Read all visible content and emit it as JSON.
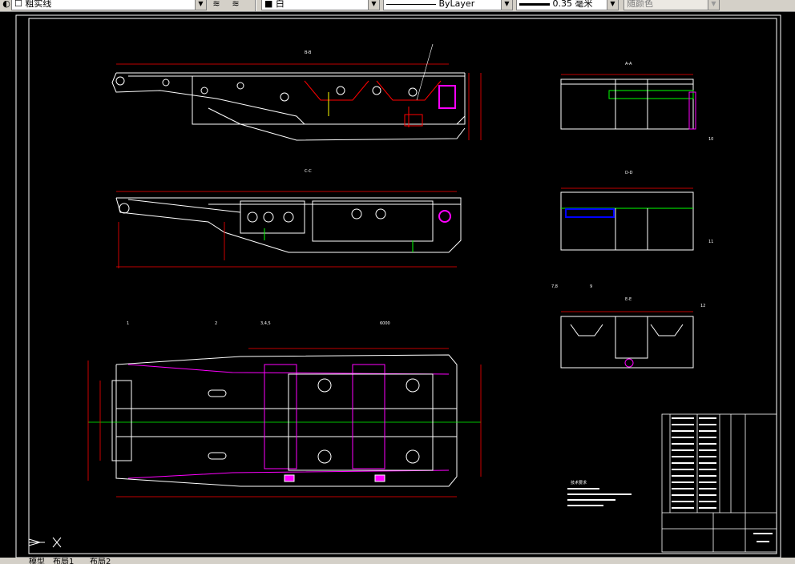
{
  "toolbar": {
    "layer_label": "粗实线",
    "color_value": "白",
    "linetype_value": "ByLayer",
    "lineweight_value": "0.35 毫米",
    "plotstyle_value": "随颜色"
  },
  "drawing": {
    "section_labels": [
      "B-B",
      "C-C",
      "A-A",
      "D-D",
      "E-E"
    ],
    "callouts": [
      "1",
      "2",
      "3,4,5",
      "6000",
      "7,8",
      "9",
      "10",
      "11",
      "12"
    ],
    "notes_title": "技术要求"
  },
  "tabs": [
    "模型",
    "布局1",
    "布局2"
  ],
  "colors": {
    "background": "#000000",
    "outline": "#ffffff",
    "dimension": "#ff0000",
    "centerline": "#00ff00",
    "highlight": "#ff00ff"
  }
}
